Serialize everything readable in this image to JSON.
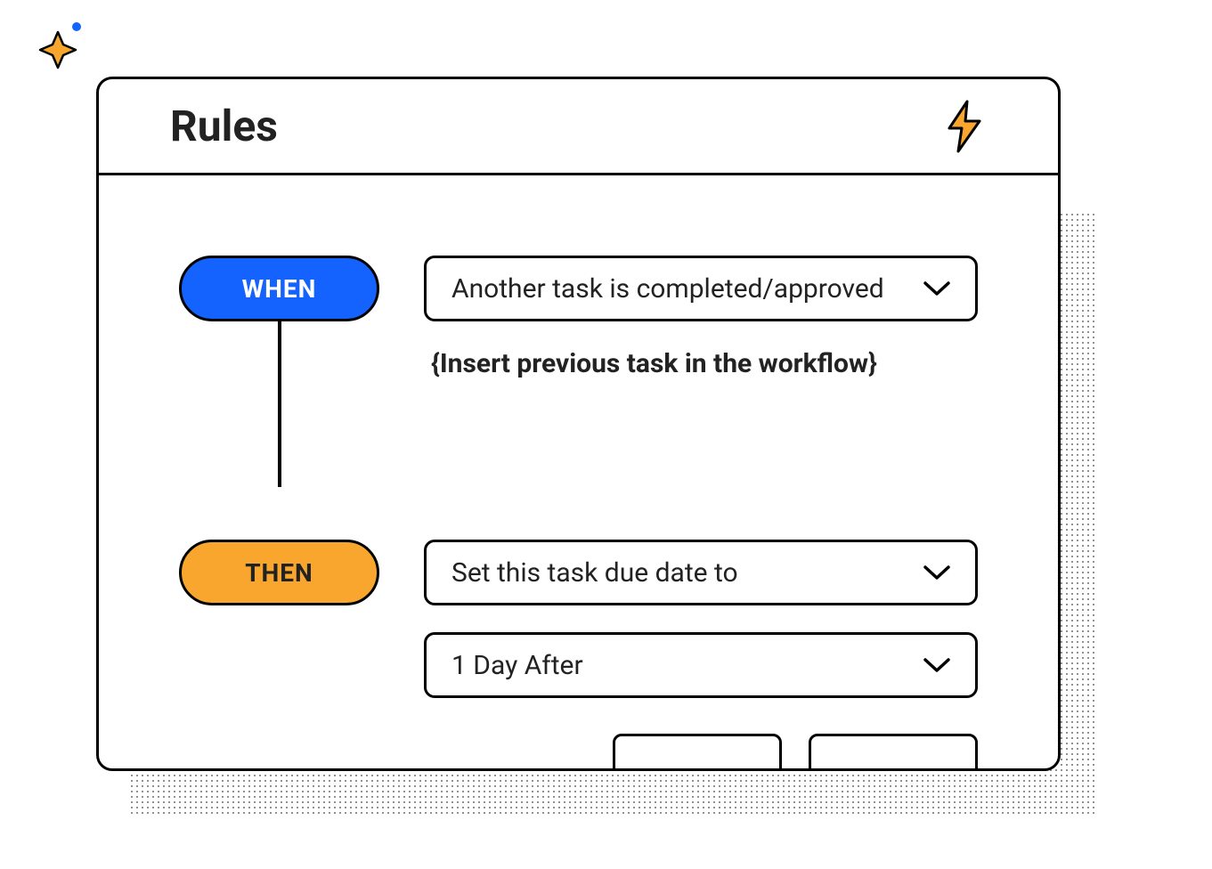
{
  "panel": {
    "title": "Rules"
  },
  "rule": {
    "when": {
      "pill_label": "WHEN",
      "condition_selected": "Another task is completed/approved",
      "placeholder_text": "{Insert previous task in the workflow}"
    },
    "then": {
      "pill_label": "THEN",
      "action_selected": "Set this task due date to",
      "offset_selected": "1 Day After"
    }
  },
  "colors": {
    "when_pill_bg": "#1463ff",
    "then_pill_bg": "#f8a62d",
    "border": "#000000"
  },
  "icons": {
    "sparkle": "sparkle-icon",
    "lightning": "lightning-icon",
    "chevron": "chevron-down-icon"
  }
}
